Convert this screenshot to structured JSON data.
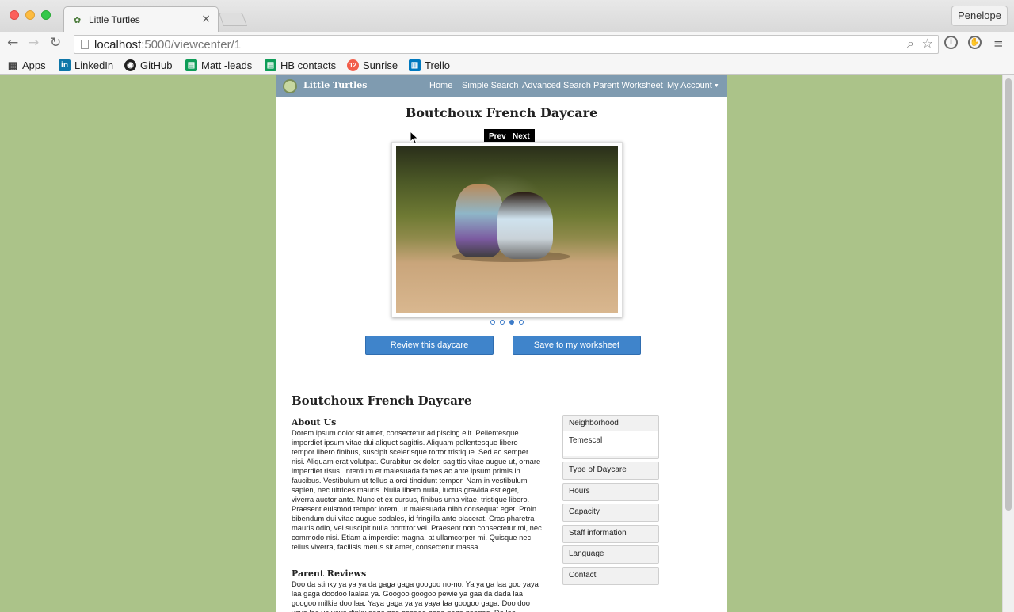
{
  "browser": {
    "tab_title": "Little Turtles",
    "tab_close": "×",
    "profile_name": "Penelope",
    "url_host": "localhost",
    "url_path": ":5000/viewcenter/1",
    "nav_back": "←",
    "nav_forward": "→",
    "nav_reload": "↻",
    "search_icon": "⌕",
    "star_icon": "☆",
    "menu_icon": "≡"
  },
  "bookmarks": [
    {
      "label": "Apps",
      "icon": "apps-grid-icon",
      "glyph": "▦"
    },
    {
      "label": "LinkedIn",
      "icon": "linkedin-icon",
      "glyph": "in"
    },
    {
      "label": "GitHub",
      "icon": "github-icon",
      "glyph": "◉"
    },
    {
      "label": "Matt -leads",
      "icon": "sheets-icon",
      "glyph": "▤"
    },
    {
      "label": "HB contacts",
      "icon": "sheets-icon",
      "glyph": "▤"
    },
    {
      "label": "Sunrise",
      "icon": "sunrise-icon",
      "glyph": "12"
    },
    {
      "label": "Trello",
      "icon": "trello-icon",
      "glyph": "▥"
    }
  ],
  "site": {
    "brand": "Little Turtles",
    "nav": {
      "home": "Home",
      "simple_search": "Simple Search",
      "advanced_search": "Advanced Search",
      "parent_worksheet": "Parent Worksheet",
      "my_account": "My Account"
    }
  },
  "daycare": {
    "name": "Boutchoux French Daycare",
    "slider": {
      "prev": "Prev",
      "next": "Next",
      "slide_count": 4,
      "active_slide": 3
    },
    "actions": {
      "review": "Review this daycare",
      "save": "Save to my worksheet"
    },
    "about_heading": "About Us",
    "about_text": "Dorem ipsum dolor sit amet, consectetur adipiscing elit. Pellentesque imperdiet ipsum vitae dui aliquet sagittis. Aliquam pellentesque libero tempor libero finibus, suscipit scelerisque tortor tristique. Sed ac semper nisi. Aliquam erat volutpat. Curabitur ex dolor, sagittis vitae augue ut, ornare imperdiet risus. Interdum et malesuada fames ac ante ipsum primis in faucibus. Vestibulum ut tellus a orci tincidunt tempor. Nam in vestibulum sapien, nec ultrices mauris. Nulla libero nulla, luctus gravida est eget, viverra auctor ante. Nunc et ex cursus, finibus urna vitae, tristique libero. Praesent euismod tempor lorem, ut malesuada nibh consequat eget. Proin bibendum dui vitae augue sodales, id fringilla ante placerat. Cras pharetra mauris odio, vel suscipit nulla porttitor vel. Praesent non consectetur mi, nec commodo nisi. Etiam a imperdiet magna, at ullamcorper mi. Quisque nec tellus viverra, facilisis metus sit amet, consectetur massa.",
    "reviews_heading": "Parent Reviews",
    "reviews_text": "Doo da stinky ya ya ya da gaga gaga googoo no-no. Ya ya ga laa goo yaya laa gaga doodoo laalaa ya. Googoo googoo pewie ya gaa da dada laa googoo milkie doo laa. Yaya gaga ya ya yaya laa googoo gaga. Doo doo yaya laa ya yaya dinky gaga goo googoo gaga gaga googoo. Da laa",
    "info": {
      "neighborhood_label": "Neighborhood",
      "neighborhood_value": "Temescal",
      "type_label": "Type of Daycare",
      "hours_label": "Hours",
      "capacity_label": "Capacity",
      "staff_label": "Staff information",
      "language_label": "Language",
      "contact_label": "Contact"
    }
  },
  "colors": {
    "page_background": "#abc389",
    "site_nav": "#7f9bb0",
    "button_blue": "#3f84cb"
  }
}
